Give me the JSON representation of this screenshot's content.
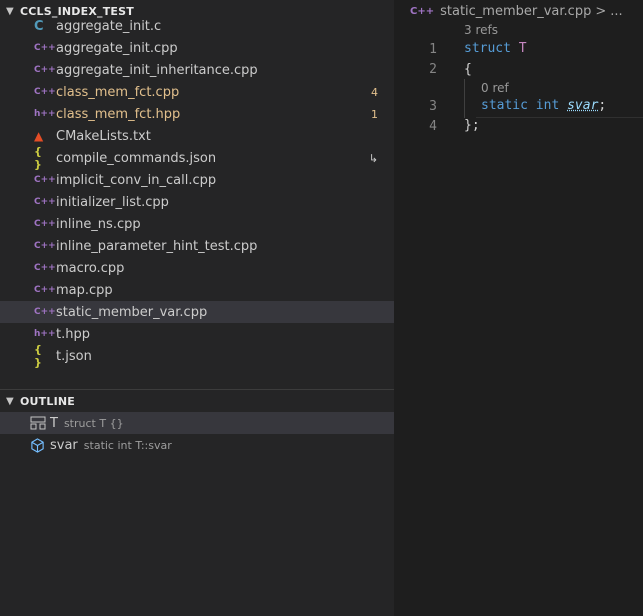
{
  "explorer": {
    "section_title": "CCLS_INDEX_TEST",
    "files": [
      {
        "name": "aggregate_init.c",
        "icon": "c-file-icon",
        "badge": "",
        "modified": false,
        "selected": false
      },
      {
        "name": "aggregate_init.cpp",
        "icon": "cpp-file-icon",
        "badge": "",
        "modified": false,
        "selected": false
      },
      {
        "name": "aggregate_init_inheritance.cpp",
        "icon": "cpp-file-icon",
        "badge": "",
        "modified": false,
        "selected": false
      },
      {
        "name": "class_mem_fct.cpp",
        "icon": "cpp-file-icon",
        "badge": "4",
        "modified": true,
        "selected": false
      },
      {
        "name": "class_mem_fct.hpp",
        "icon": "hpp-file-icon",
        "badge": "1",
        "modified": true,
        "selected": false
      },
      {
        "name": "CMakeLists.txt",
        "icon": "cmake-icon",
        "badge": "",
        "modified": false,
        "selected": false
      },
      {
        "name": "compile_commands.json",
        "icon": "json-icon",
        "badge": "↳",
        "modified": false,
        "selected": false
      },
      {
        "name": "implicit_conv_in_call.cpp",
        "icon": "cpp-file-icon",
        "badge": "",
        "modified": false,
        "selected": false
      },
      {
        "name": "initializer_list.cpp",
        "icon": "cpp-file-icon",
        "badge": "",
        "modified": false,
        "selected": false
      },
      {
        "name": "inline_ns.cpp",
        "icon": "cpp-file-icon",
        "badge": "",
        "modified": false,
        "selected": false
      },
      {
        "name": "inline_parameter_hint_test.cpp",
        "icon": "cpp-file-icon",
        "badge": "",
        "modified": false,
        "selected": false
      },
      {
        "name": "macro.cpp",
        "icon": "cpp-file-icon",
        "badge": "",
        "modified": false,
        "selected": false
      },
      {
        "name": "map.cpp",
        "icon": "cpp-file-icon",
        "badge": "",
        "modified": false,
        "selected": false
      },
      {
        "name": "static_member_var.cpp",
        "icon": "cpp-file-icon",
        "badge": "",
        "modified": false,
        "selected": true
      },
      {
        "name": "t.hpp",
        "icon": "hpp-file-icon",
        "badge": "",
        "modified": false,
        "selected": false
      },
      {
        "name": "t.json",
        "icon": "json-icon",
        "badge": "",
        "modified": false,
        "selected": false
      }
    ]
  },
  "outline": {
    "section_title": "OUTLINE",
    "items": [
      {
        "name": "T",
        "detail": "struct T {}",
        "icon": "struct-icon",
        "selected": true
      },
      {
        "name": "svar",
        "detail": "static int T::svar",
        "icon": "field-icon",
        "selected": false
      }
    ]
  },
  "editor": {
    "breadcrumb": {
      "file": "static_member_var.cpp",
      "sep": ">",
      "more": "..."
    },
    "lens_top": "3 refs",
    "lens_inner": "0 ref",
    "line_numbers": [
      "1",
      "2",
      "3",
      "4"
    ],
    "code": {
      "l1_kw": "struct",
      "l1_name": "T",
      "l2": "{",
      "l3_kw1": "static",
      "l3_kw2": "int",
      "l3_var": "svar",
      "l3_end": ";",
      "l4": "};"
    }
  },
  "colors": {
    "background": "#1e1e1e",
    "sidebar": "#252526",
    "selection": "#37373d",
    "modified": "#e2c08d",
    "keyword": "#569cd6",
    "type": "#c586c0",
    "variable": "#9cdcfe"
  }
}
